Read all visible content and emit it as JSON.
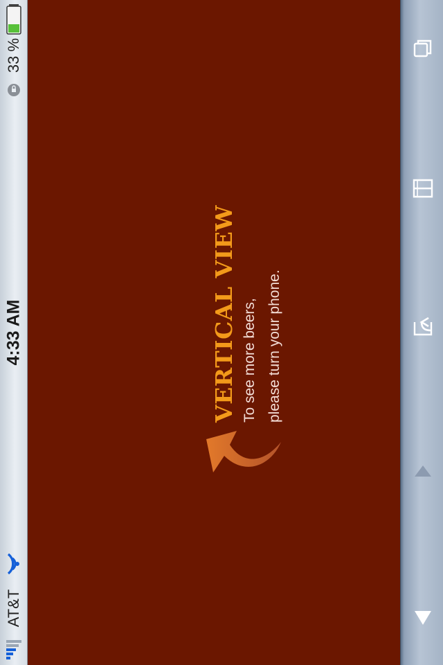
{
  "status_bar": {
    "carrier": "AT&T",
    "time": "4:33 AM",
    "battery_percent": "33 %",
    "signal_icon": "signal-bars-icon",
    "wifi_icon": "wifi-icon",
    "battery_icon": "battery-icon",
    "rotation_lock_icon": "rotation-lock-icon"
  },
  "content": {
    "title": "VERTICAL VIEW",
    "line1": "To see more beers,",
    "line2": "please turn your phone.",
    "arrow_icon": "rotate-arrow-icon"
  },
  "toolbar": {
    "items": [
      "back-arrow-icon",
      "forward-arrow-icon",
      "share-icon",
      "bookmarks-icon",
      "tabs-icon"
    ]
  },
  "colors": {
    "background": "#6b1700",
    "title": "#f39a1a",
    "text": "#f3ddd6",
    "accent_arrow": "#e27a2d"
  }
}
